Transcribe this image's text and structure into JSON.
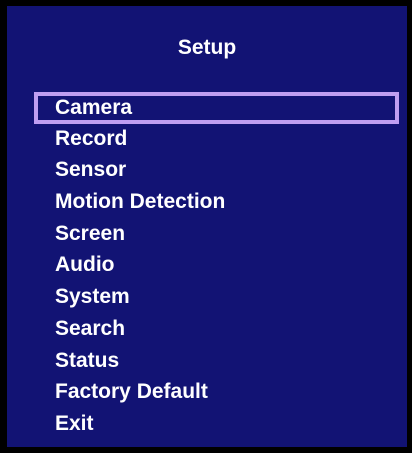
{
  "theme": {
    "background": "#121374",
    "frame": "#000000",
    "text": "#ffffff",
    "selection_border": "#bf9ef2"
  },
  "setup_menu": {
    "title": "Setup",
    "selected_item": "Camera",
    "items": [
      {
        "label": "Camera",
        "selected": true
      },
      {
        "label": "Record",
        "selected": false
      },
      {
        "label": "Sensor",
        "selected": false
      },
      {
        "label": "Motion Detection",
        "selected": false
      },
      {
        "label": "Screen",
        "selected": false
      },
      {
        "label": "Audio",
        "selected": false
      },
      {
        "label": "System",
        "selected": false
      },
      {
        "label": "Search",
        "selected": false
      },
      {
        "label": "Status",
        "selected": false
      },
      {
        "label": "Factory Default",
        "selected": false
      },
      {
        "label": "Exit",
        "selected": false
      }
    ]
  }
}
